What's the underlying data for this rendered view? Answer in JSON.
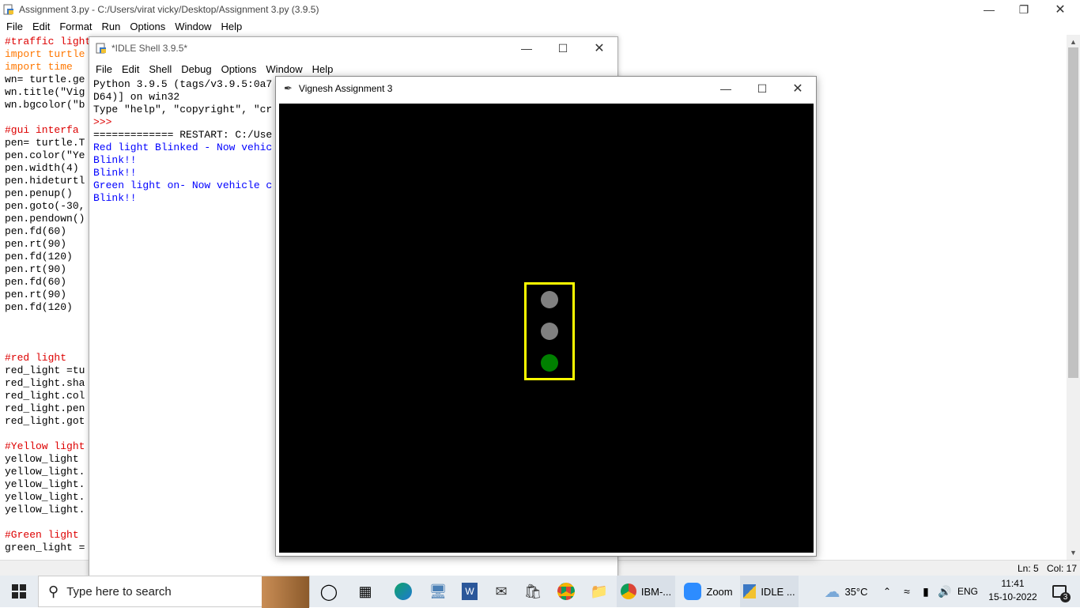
{
  "editor": {
    "title": "Assignment 3.py - C:/Users/virat vicky/Desktop/Assignment 3.py (3.9.5)",
    "menu": [
      "File",
      "Edit",
      "Format",
      "Run",
      "Options",
      "Window",
      "Help"
    ],
    "lines": [
      {
        "c": "cm",
        "t": "#traffic light"
      },
      {
        "c": "kw",
        "t": "import turtle"
      },
      {
        "c": "kw",
        "t": "import time"
      },
      {
        "c": "",
        "t": "wn= turtle.ge"
      },
      {
        "c": "",
        "t": "wn.title(\"Vig"
      },
      {
        "c": "",
        "t": "wn.bgcolor(\"b"
      },
      {
        "c": "",
        "t": ""
      },
      {
        "c": "cm",
        "t": "#gui interfa"
      },
      {
        "c": "",
        "t": "pen= turtle.T"
      },
      {
        "c": "",
        "t": "pen.color(\"Ye"
      },
      {
        "c": "",
        "t": "pen.width(4)"
      },
      {
        "c": "",
        "t": "pen.hideturtl"
      },
      {
        "c": "",
        "t": "pen.penup()"
      },
      {
        "c": "",
        "t": "pen.goto(-30,"
      },
      {
        "c": "",
        "t": "pen.pendown()"
      },
      {
        "c": "",
        "t": "pen.fd(60)"
      },
      {
        "c": "",
        "t": "pen.rt(90)"
      },
      {
        "c": "",
        "t": "pen.fd(120)"
      },
      {
        "c": "",
        "t": "pen.rt(90)"
      },
      {
        "c": "",
        "t": "pen.fd(60)"
      },
      {
        "c": "",
        "t": "pen.rt(90)"
      },
      {
        "c": "",
        "t": "pen.fd(120)"
      },
      {
        "c": "",
        "t": ""
      },
      {
        "c": "",
        "t": ""
      },
      {
        "c": "",
        "t": ""
      },
      {
        "c": "cm",
        "t": "#red light"
      },
      {
        "c": "",
        "t": "red_light =tu"
      },
      {
        "c": "",
        "t": "red_light.sha"
      },
      {
        "c": "",
        "t": "red_light.col"
      },
      {
        "c": "",
        "t": "red_light.pen"
      },
      {
        "c": "",
        "t": "red_light.got"
      },
      {
        "c": "",
        "t": ""
      },
      {
        "c": "cm",
        "t": "#Yellow light"
      },
      {
        "c": "",
        "t": "yellow_light "
      },
      {
        "c": "",
        "t": "yellow_light."
      },
      {
        "c": "",
        "t": "yellow_light."
      },
      {
        "c": "",
        "t": "yellow_light."
      },
      {
        "c": "",
        "t": "yellow_light."
      },
      {
        "c": "",
        "t": ""
      },
      {
        "c": "cm",
        "t": "#Green light"
      },
      {
        "c": "",
        "t": "green_light ="
      }
    ],
    "status": {
      "ln": "Ln: 5",
      "col": "Col: 17"
    }
  },
  "shell": {
    "title": "*IDLE Shell 3.9.5*",
    "menu": [
      "File",
      "Edit",
      "Shell",
      "Debug",
      "Options",
      "Window",
      "Help"
    ],
    "lines": [
      {
        "c": "",
        "t": "Python 3.9.5 (tags/v3.9.5:0a7"
      },
      {
        "c": "",
        "t": "D64)] on win32"
      },
      {
        "c": "",
        "t": "Type \"help\", \"copyright\", \"cr"
      },
      {
        "c": "cm",
        "t": ">>>"
      },
      {
        "c": "",
        "t": "============= RESTART: C:/Use"
      },
      {
        "c": "blue",
        "t": "Red light Blinked - Now vehic"
      },
      {
        "c": "blue",
        "t": "Blink!!"
      },
      {
        "c": "blue",
        "t": "Blink!!"
      },
      {
        "c": "blue",
        "t": "Green light on- Now vehicle c"
      },
      {
        "c": "blue",
        "t": "Blink!!"
      }
    ]
  },
  "turtle": {
    "title": "Vignesh Assignment 3",
    "lights": [
      {
        "name": "red-light",
        "color": "#808080"
      },
      {
        "name": "yellow-light",
        "color": "#808080"
      },
      {
        "name": "green-light",
        "color": "#008000"
      }
    ],
    "frame_color": "#ffff00"
  },
  "taskbar": {
    "search_placeholder": "Type here to search",
    "apps": [
      {
        "icon": "chrome-icon",
        "label": "IBM-..."
      },
      {
        "icon": "zoom-icon",
        "label": "Zoom"
      },
      {
        "icon": "idle-icon",
        "label": "IDLE ..."
      }
    ],
    "weather": "35°C",
    "language": "ENG",
    "time": "11:41",
    "date": "15-10-2022",
    "notifications": "3"
  }
}
